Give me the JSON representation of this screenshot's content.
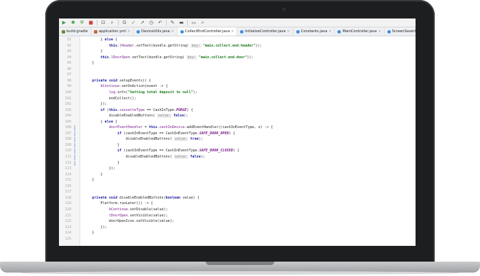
{
  "toolbar": {
    "icons": [
      "run-icon",
      "debug-icon",
      "coverage-icon",
      "stop-icon",
      "build-icon",
      "search-icon",
      "git-icon",
      "check-icon",
      "arrow-icon",
      "history-icon",
      "revert-icon",
      "wrench-icon",
      "folder-icon",
      "layout-icon",
      "search2-icon"
    ]
  },
  "tabs": [
    {
      "label": "build.gradle",
      "kind": "gradle"
    },
    {
      "label": "application.yml",
      "kind": "yml"
    },
    {
      "label": "DeviceUtils.java",
      "kind": "java"
    },
    {
      "label": "CollectEndController.java",
      "kind": "java"
    },
    {
      "label": "InitializeController.java",
      "kind": "java"
    },
    {
      "label": "Constants.java",
      "kind": "java"
    },
    {
      "label": "MainController.java",
      "kind": "java"
    },
    {
      "label": "ScreenSaverController.java",
      "kind": "java"
    }
  ],
  "lines": [
    {
      "n": "91",
      "html": "        } else {"
    },
    {
      "n": "92",
      "html": "            this.lHeader.setText(bundle.getString( key: \"main.collect.end.header\"));"
    },
    {
      "n": "93",
      "html": "        }"
    },
    {
      "n": "94",
      "html": "        this.lDoorOpen.setText(bundle.getString( key: \"main.collect.end.door\"));"
    },
    {
      "n": "95",
      "html": "    }"
    },
    {
      "n": "96",
      "html": ""
    },
    {
      "n": "97",
      "html": ""
    },
    {
      "n": "98",
      "html": "    private void setupEvents() {"
    },
    {
      "n": "99",
      "html": "        bContinue.setOnAction(event -> {"
    },
    {
      "n": "100",
      "html": "            log.info(\"Setting total deposit to null\");"
    },
    {
      "n": "101",
      "html": "            endCollect();"
    },
    {
      "n": "102",
      "html": "        });"
    },
    {
      "n": "103",
      "html": "        if (this.cassetteType == CashInType.PURGE) {"
    },
    {
      "n": "104",
      "html": "            disableEnabledButtons( value: false);"
    },
    {
      "n": "105",
      "html": "        } else {"
    },
    {
      "n": "106",
      "html": "            doorEventHandler = this.cashInDevice.addEventHandler((cashInEventType, o) -> {"
    },
    {
      "n": "107",
      "html": "                if (cashInEventType == CashInEventType.SAFE_DOOR_OPEN) {"
    },
    {
      "n": "108",
      "html": "                    disableEnabledButtons( value: true);"
    },
    {
      "n": "109",
      "html": "                }"
    },
    {
      "n": "110",
      "html": "                if (cashInEventType == CashInEventType.SAFE_DOOR_CLOSED) {"
    },
    {
      "n": "111",
      "html": "                    disableEnabledButtons( value: false);"
    },
    {
      "n": "112",
      "html": "                }"
    },
    {
      "n": "113",
      "html": "            });"
    },
    {
      "n": "114",
      "html": "        }"
    },
    {
      "n": "115",
      "html": "    }"
    },
    {
      "n": "116",
      "html": ""
    },
    {
      "n": "117",
      "html": ""
    },
    {
      "n": "118",
      "html": "    private void disableEnabledButtons(boolean value) {"
    },
    {
      "n": "119",
      "html": "        Platform.runLater(() -> {"
    },
    {
      "n": "120",
      "html": "            bContinue.setDisable(value);"
    },
    {
      "n": "121",
      "html": "            lDoorOpen.setVisible(value);"
    },
    {
      "n": "122",
      "html": "            doorOpenIcon.setVisible(value);"
    },
    {
      "n": "123",
      "html": "        });"
    },
    {
      "n": "124",
      "html": "    }"
    },
    {
      "n": "125",
      "html": ""
    }
  ]
}
